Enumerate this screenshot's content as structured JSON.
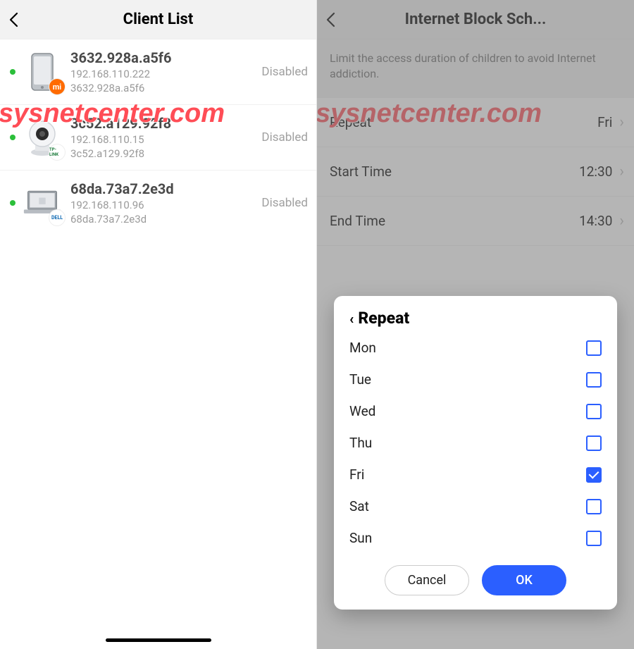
{
  "watermark_text": "sysnetcenter.com",
  "left": {
    "title": "Client List",
    "clients": [
      {
        "name": "3632.928a.a5f6",
        "ip": "192.168.110.222",
        "mac": "3632.928a.a5f6",
        "status": "Disabled",
        "device": "phone",
        "badge": "mi",
        "badge_text": "mi"
      },
      {
        "name": "3c52.a129.92f8",
        "ip": "192.168.110.15",
        "mac": "3c52.a129.92f8",
        "status": "Disabled",
        "device": "camera",
        "badge": "tplink",
        "badge_text": "TP-LINK"
      },
      {
        "name": "68da.73a7.2e3d",
        "ip": "192.168.110.96",
        "mac": "68da.73a7.2e3d",
        "status": "Disabled",
        "device": "laptop",
        "badge": "dell",
        "badge_text": "DELL"
      }
    ]
  },
  "right": {
    "title": "Internet Block Sch...",
    "info": "Limit the access duration of children to avoid Internet addiction.",
    "settings": {
      "repeat_label": "Repeat",
      "repeat_value": "Fri",
      "start_label": "Start Time",
      "start_value": "12:30",
      "end_label": "End Time",
      "end_value": "14:30"
    },
    "modal": {
      "title": "Repeat",
      "days": [
        {
          "label": "Mon",
          "checked": false
        },
        {
          "label": "Tue",
          "checked": false
        },
        {
          "label": "Wed",
          "checked": false
        },
        {
          "label": "Thu",
          "checked": false
        },
        {
          "label": "Fri",
          "checked": true
        },
        {
          "label": "Sat",
          "checked": false
        },
        {
          "label": "Sun",
          "checked": false
        }
      ],
      "cancel_label": "Cancel",
      "ok_label": "OK"
    }
  }
}
